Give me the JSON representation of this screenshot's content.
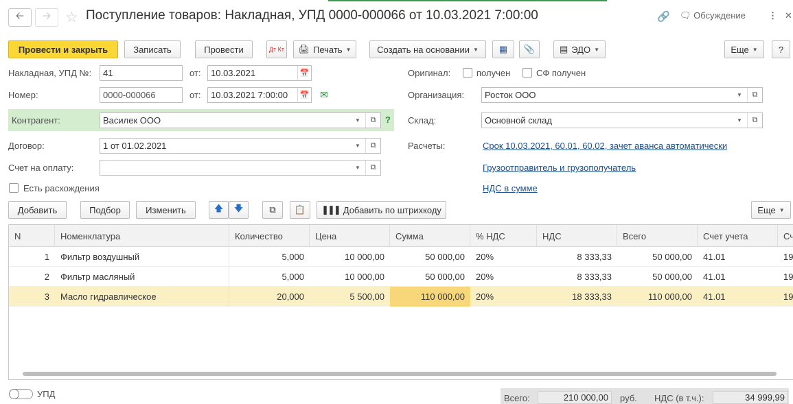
{
  "window": {
    "title": "Поступление товаров: Накладная, УПД 0000-000066 от 10.03.2021 7:00:00",
    "discuss": "Обсуждение"
  },
  "toolbar": {
    "post_close": "Провести и закрыть",
    "save": "Записать",
    "post": "Провести",
    "dtkt": "Дт Кт",
    "print": "Печать",
    "create_base": "Создать на основании",
    "edo": "ЭДО",
    "more": "Еще",
    "help": "?"
  },
  "form": {
    "invoice_label": "Накладная, УПД №:",
    "invoice_value": "41",
    "from_label": "от:",
    "invoice_date": "10.03.2021",
    "number_label": "Номер:",
    "number_value": "0000-000066",
    "number_date": "10.03.2021  7:00:00",
    "counterparty_label": "Контрагент:",
    "counterparty_value": "Василек ООО",
    "counterparty_help": "?",
    "contract_label": "Договор:",
    "contract_value": "1 от 01.02.2021",
    "payment_label": "Счет на оплату:",
    "payment_value": "",
    "discrepancy_label": "Есть расхождения",
    "original_label": "Оригинал:",
    "received_label": "получен",
    "sf_received_label": "СФ получен",
    "org_label": "Организация:",
    "org_value": "Росток ООО",
    "warehouse_label": "Склад:",
    "warehouse_value": "Основной склад",
    "settlements_label": "Расчеты:",
    "settlements_link": "Срок 10.03.2021, 60.01, 60.02, зачет аванса автоматически",
    "shipper_link": "Грузоотправитель и грузополучатель",
    "vat_link": "НДС в сумме"
  },
  "table_toolbar": {
    "add": "Добавить",
    "pick": "Подбор",
    "edit": "Изменить",
    "barcode": "Добавить по штрихкоду",
    "more": "Еще"
  },
  "table": {
    "headers": [
      "N",
      "Номенклатура",
      "Количество",
      "Цена",
      "Сумма",
      "% НДС",
      "НДС",
      "Всего",
      "Счет учета",
      "Сч"
    ],
    "rows": [
      [
        "1",
        "Фильтр воздушный",
        "5,000",
        "10 000,00",
        "50 000,00",
        "20%",
        "8 333,33",
        "50 000,00",
        "41.01",
        "19"
      ],
      [
        "2",
        "Фильтр масляный",
        "5,000",
        "10 000,00",
        "50 000,00",
        "20%",
        "8 333,33",
        "50 000,00",
        "41.01",
        "19"
      ],
      [
        "3",
        "Масло гидравлическое",
        "20,000",
        "5 500,00",
        "110 000,00",
        "20%",
        "18 333,33",
        "110 000,00",
        "41.01",
        "19"
      ]
    ]
  },
  "footer": {
    "upd_label": "УПД",
    "total_label": "Всего:",
    "total_value": "210 000,00",
    "currency": "руб.",
    "vat_label": "НДС (в т.ч.):",
    "vat_value": "34 999,99"
  }
}
